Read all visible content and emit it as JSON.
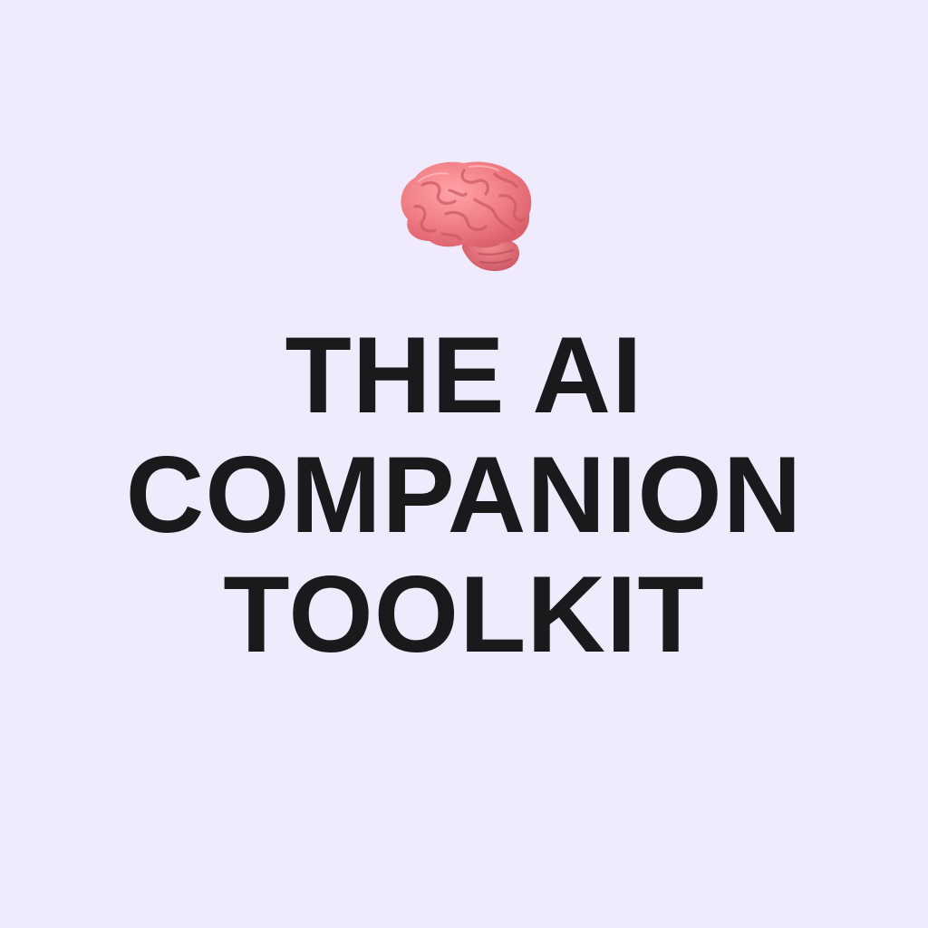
{
  "icon": {
    "name": "brain-icon",
    "color": "#f07c84"
  },
  "title": {
    "lines": [
      "THE AI",
      "COMPANION",
      "TOOLKIT"
    ],
    "color": "#1a1a1c"
  },
  "background": "#efebfc"
}
